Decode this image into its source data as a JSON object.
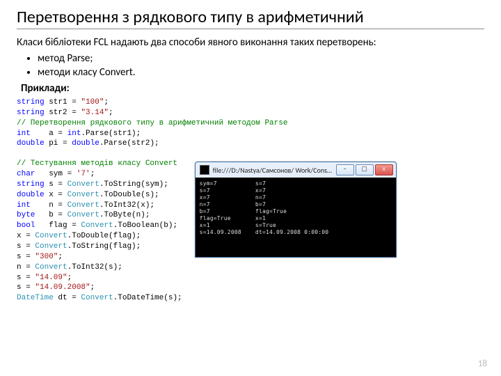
{
  "title": "Перетворення з рядкового типу в арифметичний",
  "intro": "Класи бібліотеки FCL надають два способи явного виконання таких перетворень:",
  "bullets": [
    "метод Parse;",
    "методи класу Convert."
  ],
  "examples_label": "Приклади:",
  "code_upper": [
    {
      "t": "string",
      "c": "kw"
    },
    {
      "t": " str1 = "
    },
    {
      "t": "\"100\"",
      "c": "str"
    },
    {
      "t": ";\n"
    },
    {
      "t": "string",
      "c": "kw"
    },
    {
      "t": " str2 = "
    },
    {
      "t": "\"3.14\"",
      "c": "str"
    },
    {
      "t": ";\n"
    },
    {
      "t": "// Перетворення рядкового типу в арифметичний методом Parse",
      "c": "com"
    },
    {
      "t": "\n"
    },
    {
      "t": "int",
      "c": "kw"
    },
    {
      "t": "    a = "
    },
    {
      "t": "int",
      "c": "kw"
    },
    {
      "t": ".Parse(str1);\n"
    },
    {
      "t": "double",
      "c": "kw"
    },
    {
      "t": " pi = "
    },
    {
      "t": "double",
      "c": "kw"
    },
    {
      "t": ".Parse(str2);"
    }
  ],
  "code_lower": [
    {
      "t": "// Тестування методів класу Convert",
      "c": "com"
    },
    {
      "t": "\n"
    },
    {
      "t": "char",
      "c": "kw"
    },
    {
      "t": "   sym = "
    },
    {
      "t": "'7'",
      "c": "str"
    },
    {
      "t": ";\n"
    },
    {
      "t": "string",
      "c": "kw"
    },
    {
      "t": " s = "
    },
    {
      "t": "Convert",
      "c": "cls"
    },
    {
      "t": ".ToString(sym);\n"
    },
    {
      "t": "double",
      "c": "kw"
    },
    {
      "t": " x = "
    },
    {
      "t": "Convert",
      "c": "cls"
    },
    {
      "t": ".ToDouble(s);\n"
    },
    {
      "t": "int",
      "c": "kw"
    },
    {
      "t": "    n = "
    },
    {
      "t": "Convert",
      "c": "cls"
    },
    {
      "t": ".ToInt32(x);\n"
    },
    {
      "t": "byte",
      "c": "kw"
    },
    {
      "t": "   b = "
    },
    {
      "t": "Convert",
      "c": "cls"
    },
    {
      "t": ".ToByte(n);\n"
    },
    {
      "t": "bool",
      "c": "kw"
    },
    {
      "t": "   flag = "
    },
    {
      "t": "Convert",
      "c": "cls"
    },
    {
      "t": ".ToBoolean(b);\n"
    },
    {
      "t": "x = "
    },
    {
      "t": "Convert",
      "c": "cls"
    },
    {
      "t": ".ToDouble(flag);\n"
    },
    {
      "t": "s = "
    },
    {
      "t": "Convert",
      "c": "cls"
    },
    {
      "t": ".ToString(flag);\n"
    },
    {
      "t": "s = "
    },
    {
      "t": "\"300\"",
      "c": "str"
    },
    {
      "t": ";\n"
    },
    {
      "t": "n = "
    },
    {
      "t": "Convert",
      "c": "cls"
    },
    {
      "t": ".ToInt32(s);\n"
    },
    {
      "t": "s = "
    },
    {
      "t": "\"14.09\"",
      "c": "str"
    },
    {
      "t": ";\n"
    },
    {
      "t": "s = "
    },
    {
      "t": "\"14.09.2008\"",
      "c": "str"
    },
    {
      "t": ";\n"
    },
    {
      "t": "DateTime",
      "c": "cls"
    },
    {
      "t": " dt = "
    },
    {
      "t": "Convert",
      "c": "cls"
    },
    {
      "t": ".ToDateTime(s);"
    }
  ],
  "console": {
    "title": "file:///D:/Nastya/Самсонов/ Work/Console…",
    "lines": [
      "sym=7           s=7",
      "s=7             x=7",
      "x=7             n=7",
      "n=7             b=7",
      "b=7             flag=True",
      "flag=True       x=1",
      "x=1             s=True",
      "s=14.09.2008    dt=14.09.2008 0:00:00"
    ]
  },
  "page_number": "18"
}
